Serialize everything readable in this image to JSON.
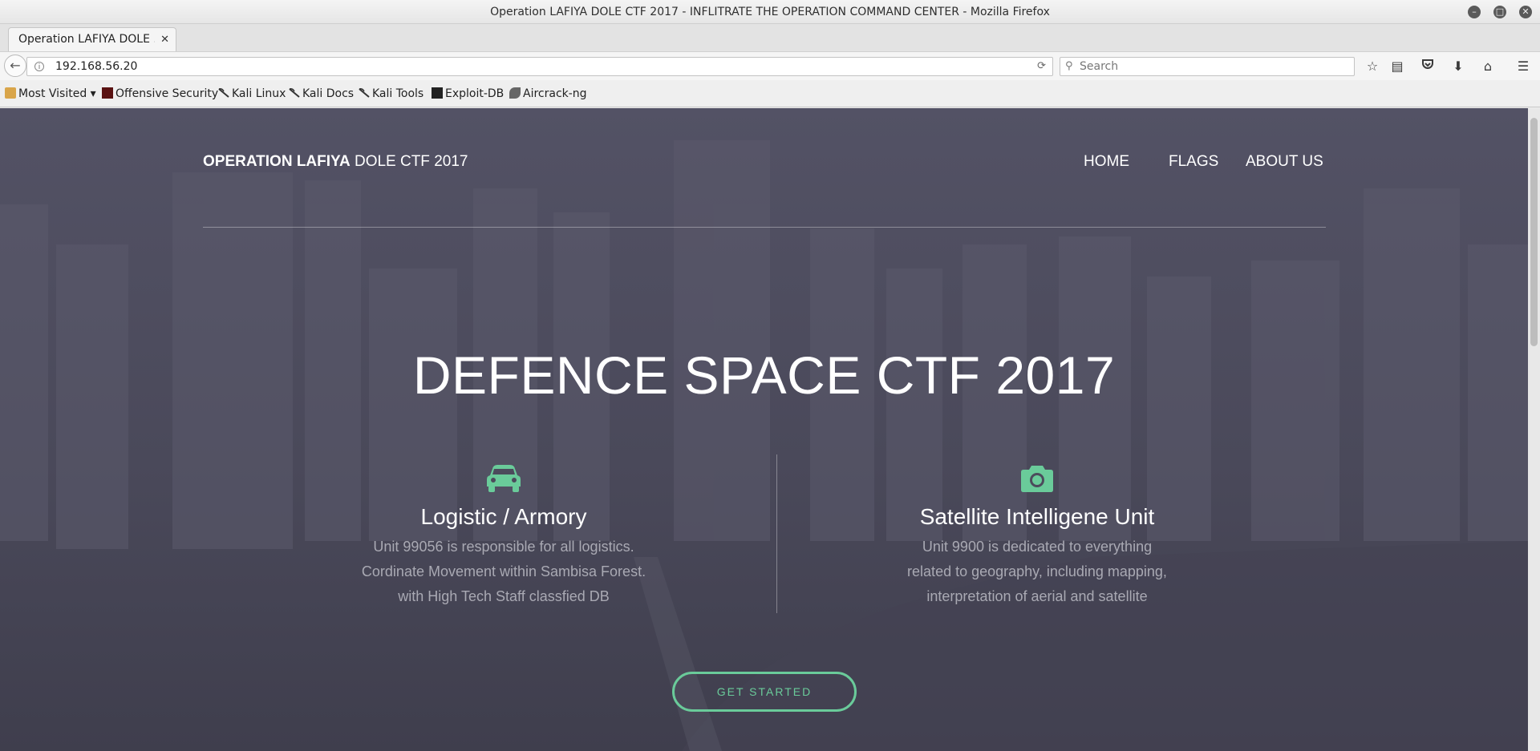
{
  "window": {
    "title": "Operation LAFIYA DOLE CTF 2017 - INFLITRATE THE OPERATION COMMAND CENTER - Mozilla Firefox"
  },
  "tabs": [
    {
      "label": "Operation LAFIYA DOLE ...",
      "close": "✕"
    }
  ],
  "newtab_label": "+",
  "navbar": {
    "url": "192.168.56.20",
    "search_placeholder": "Search"
  },
  "bookmarks": [
    {
      "label": "Most Visited ▾",
      "icon": "folder-icon"
    },
    {
      "label": "Offensive Security",
      "icon": "offsec-icon"
    },
    {
      "label": "Kali Linux",
      "icon": "kali-icon"
    },
    {
      "label": "Kali Docs",
      "icon": "kali-icon"
    },
    {
      "label": "Kali Tools",
      "icon": "kali-icon"
    },
    {
      "label": "Exploit-DB",
      "icon": "exploitdb-icon"
    },
    {
      "label": "Aircrack-ng",
      "icon": "aircrack-icon"
    }
  ],
  "page": {
    "brand_bold": "OPERATION LAFIYA",
    "brand_rest": " DOLE CTF 2017",
    "nav": [
      "HOME",
      "FLAGS",
      "ABOUT US"
    ],
    "hero_title": "DEFENCE SPACE CTF 2017",
    "features": [
      {
        "icon": "car-icon",
        "title": "Logistic / Armory",
        "lines": [
          "Unit 99056 is responsible for all logistics.",
          "Cordinate Movement within Sambisa Forest.",
          "with High Tech Staff classfied DB"
        ]
      },
      {
        "icon": "camera-icon",
        "title": "Satellite Intelligene Unit",
        "lines": [
          "Unit 9900 is dedicated to everything",
          "related to geography, including mapping,",
          "interpretation of aerial and satellite"
        ]
      }
    ],
    "cta_label": "GET STARTED"
  },
  "colors": {
    "accent": "#6acb9a",
    "page_overlay": "#4c4b5c"
  }
}
